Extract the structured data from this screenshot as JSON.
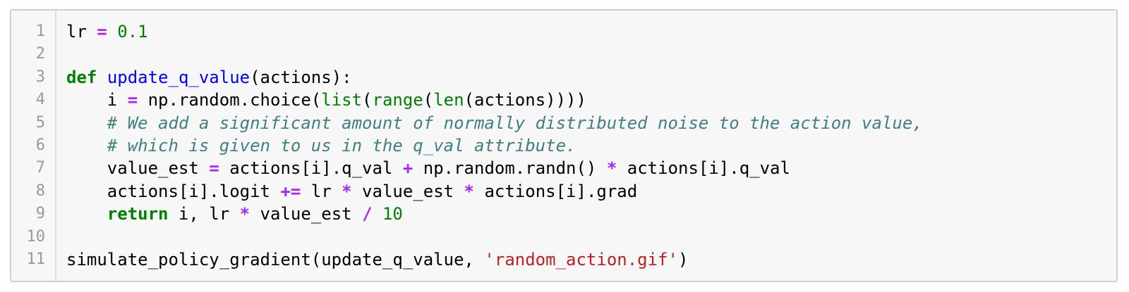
{
  "cell": {
    "line_numbers": [
      "1",
      "2",
      "3",
      "4",
      "5",
      "6",
      "7",
      "8",
      "9",
      "10",
      "11"
    ],
    "lines": [
      [
        {
          "t": "lr",
          "k": "plain"
        },
        {
          "t": " ",
          "k": "plain"
        },
        {
          "t": "=",
          "k": "operator"
        },
        {
          "t": " ",
          "k": "plain"
        },
        {
          "t": "0.1",
          "k": "number"
        }
      ],
      [],
      [
        {
          "t": "def",
          "k": "keyword"
        },
        {
          "t": " ",
          "k": "plain"
        },
        {
          "t": "update_q_value",
          "k": "funcname"
        },
        {
          "t": "(actions):",
          "k": "plain"
        }
      ],
      [
        {
          "t": "    i ",
          "k": "plain"
        },
        {
          "t": "=",
          "k": "operator"
        },
        {
          "t": " np.random.choice(",
          "k": "plain"
        },
        {
          "t": "list",
          "k": "builtin"
        },
        {
          "t": "(",
          "k": "plain"
        },
        {
          "t": "range",
          "k": "builtin"
        },
        {
          "t": "(",
          "k": "plain"
        },
        {
          "t": "len",
          "k": "builtin"
        },
        {
          "t": "(actions))))",
          "k": "plain"
        }
      ],
      [
        {
          "t": "    ",
          "k": "plain"
        },
        {
          "t": "# We add a significant amount of normally distributed noise to the action value,",
          "k": "comment"
        }
      ],
      [
        {
          "t": "    ",
          "k": "plain"
        },
        {
          "t": "# which is given to us in the q_val attribute.",
          "k": "comment"
        }
      ],
      [
        {
          "t": "    value_est ",
          "k": "plain"
        },
        {
          "t": "=",
          "k": "operator"
        },
        {
          "t": " actions[i].q_val ",
          "k": "plain"
        },
        {
          "t": "+",
          "k": "operator"
        },
        {
          "t": " np.random.randn() ",
          "k": "plain"
        },
        {
          "t": "*",
          "k": "operator"
        },
        {
          "t": " actions[i].q_val",
          "k": "plain"
        }
      ],
      [
        {
          "t": "    actions[i].logit ",
          "k": "plain"
        },
        {
          "t": "+=",
          "k": "operator"
        },
        {
          "t": " lr ",
          "k": "plain"
        },
        {
          "t": "*",
          "k": "operator"
        },
        {
          "t": " value_est ",
          "k": "plain"
        },
        {
          "t": "*",
          "k": "operator"
        },
        {
          "t": " actions[i].grad",
          "k": "plain"
        }
      ],
      [
        {
          "t": "    ",
          "k": "plain"
        },
        {
          "t": "return",
          "k": "keyword"
        },
        {
          "t": " i, lr ",
          "k": "plain"
        },
        {
          "t": "*",
          "k": "operator"
        },
        {
          "t": " value_est ",
          "k": "plain"
        },
        {
          "t": "/",
          "k": "operator"
        },
        {
          "t": " ",
          "k": "plain"
        },
        {
          "t": "10",
          "k": "number"
        }
      ],
      [],
      [
        {
          "t": "simulate_policy_gradient(update_q_value, ",
          "k": "plain"
        },
        {
          "t": "'random_action.gif'",
          "k": "string"
        },
        {
          "t": ")",
          "k": "plain"
        }
      ]
    ]
  },
  "colors": {
    "keyword": "#008000",
    "operator": "#aa22ff",
    "number": "#008000",
    "funcname": "#0000ff",
    "builtin": "#008000",
    "comment": "#408080",
    "string": "#ba2121",
    "background": "#f7f7f7",
    "border": "#cfcfcf",
    "gutter_text": "#999999"
  }
}
